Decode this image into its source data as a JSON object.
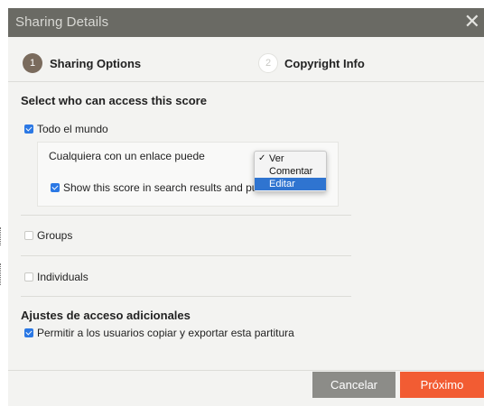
{
  "dialog": {
    "title": "Sharing Details",
    "close_symbol": "✕"
  },
  "steps": [
    {
      "number": "1",
      "label": "Sharing Options",
      "active": true
    },
    {
      "number": "2",
      "label": "Copyright Info",
      "active": false
    }
  ],
  "access": {
    "heading": "Select who can access this score",
    "everyone_label": "Todo el mundo",
    "everyone_checked": true,
    "link_permission_label": "Cualquiera con un enlace puede",
    "search_label": "Show this score in search results and public",
    "search_checked": true,
    "groups_label": "Groups",
    "groups_checked": false,
    "individuals_label": "Individuals",
    "individuals_checked": false
  },
  "permission_dropdown": {
    "options": [
      "Ver",
      "Comentar",
      "Editar"
    ],
    "checked": "Ver",
    "highlighted": "Editar",
    "checkmark": "✓"
  },
  "additional": {
    "heading": "Ajustes de acceso adicionales",
    "copy_export_label": "Permitir a los usuarios copiar y exportar esta partitura",
    "copy_export_checked": true
  },
  "footer": {
    "cancel_label": "Cancelar",
    "next_label": "Próximo"
  },
  "colors": {
    "titlebar": "#6a6a64",
    "accent_checkbox": "#2b78e4",
    "next_button": "#f25c33",
    "cancel_button": "#8c8c88",
    "step_active": "#7a6b5d"
  }
}
